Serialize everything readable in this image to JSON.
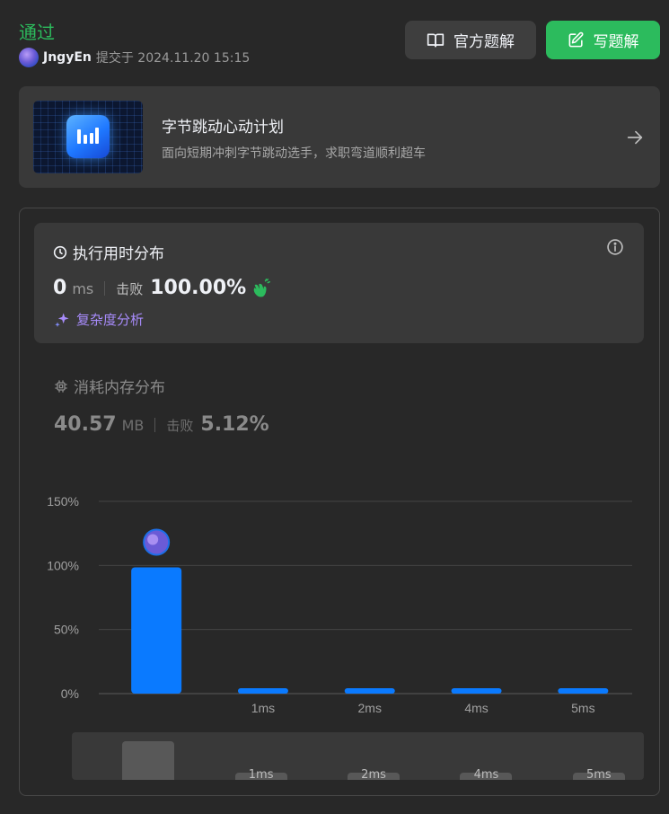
{
  "header": {
    "status": "通过",
    "username": "JngyEn",
    "submitted_text": "提交于 2024.11.20 15:15",
    "official_solution_label": "官方题解",
    "write_solution_label": "写题解"
  },
  "banner": {
    "title": "字节跳动心动计划",
    "subtitle": "面向短期冲刺字节跳动选手，求职弯道顺利超车"
  },
  "runtime": {
    "title": "执行用时分布",
    "value": "0",
    "unit": "ms",
    "beats_label": "击败",
    "beats_value": "100.00%",
    "complexity_label": "复杂度分析"
  },
  "memory": {
    "title": "消耗内存分布",
    "value": "40.57",
    "unit": "MB",
    "beats_label": "击败",
    "beats_value": "5.12%"
  },
  "colors": {
    "accepted": "#2cbb5d",
    "bar": "#0a7aff",
    "purple": "#a78bfa"
  },
  "chart_data": {
    "type": "bar",
    "categories": [
      "",
      "1ms",
      "2ms",
      "4ms",
      "5ms"
    ],
    "values": [
      98.5,
      3.5,
      3.5,
      3.5,
      3.5
    ],
    "highlight_index": 0,
    "ylim": [
      0,
      150
    ],
    "yticks": [
      "0%",
      "50%",
      "100%",
      "150%"
    ],
    "ytick_values": [
      0,
      50,
      100,
      150
    ],
    "grid": true
  },
  "navigator": {
    "labels": [
      "1ms",
      "2ms",
      "4ms",
      "5ms"
    ]
  }
}
